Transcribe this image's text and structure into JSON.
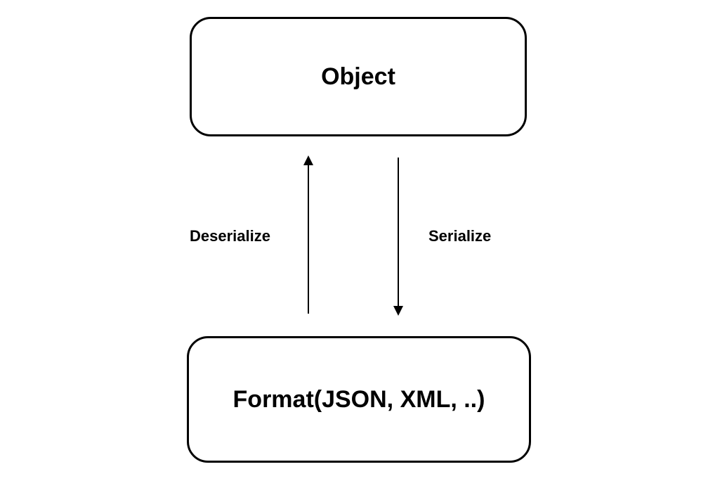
{
  "top_box": {
    "label": "Object"
  },
  "bottom_box": {
    "label": "Format(JSON, XML, ..)"
  },
  "arrows": {
    "left_label": "Deserialize",
    "right_label": "Serialize"
  }
}
